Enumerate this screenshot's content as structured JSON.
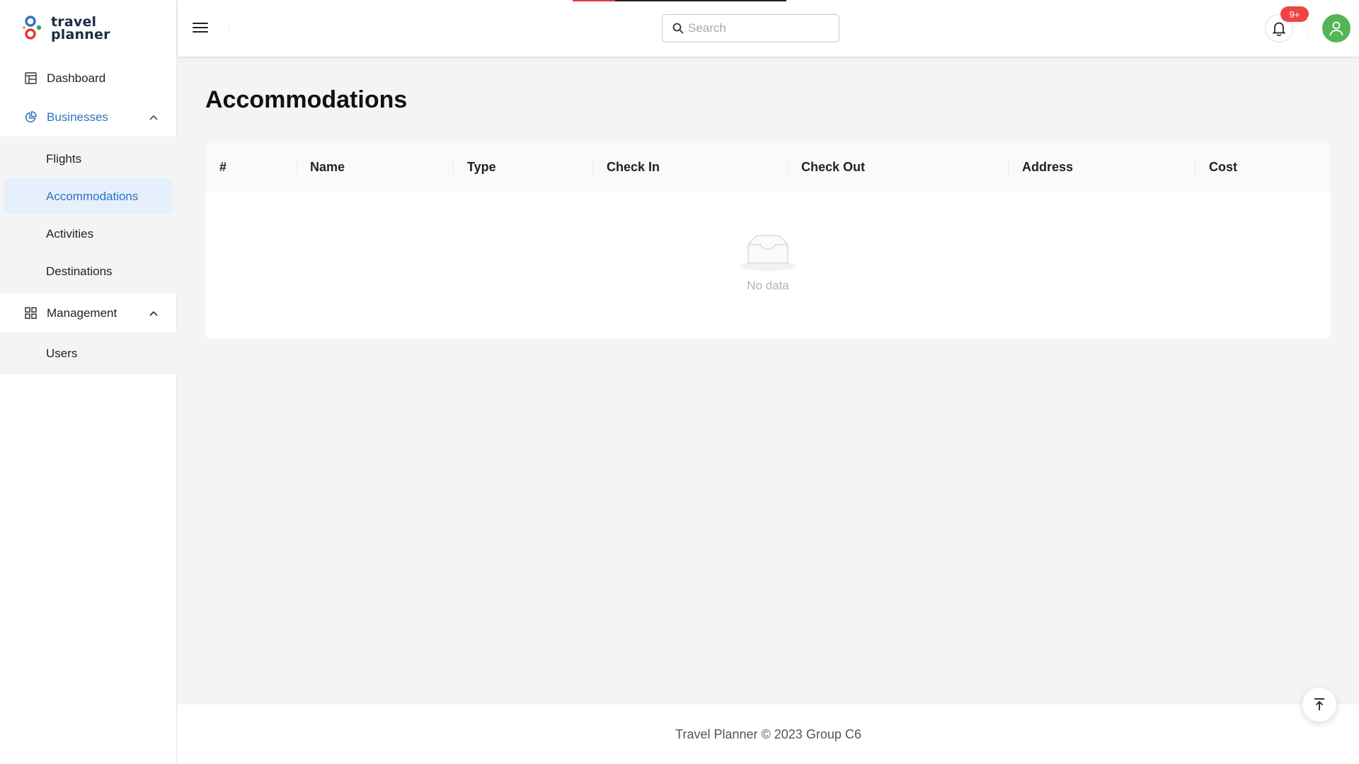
{
  "brand": {
    "line1": "travel",
    "line2": "planner"
  },
  "sidebar": {
    "items": [
      {
        "label": "Dashboard",
        "icon": "dashboard-icon"
      },
      {
        "label": "Businesses",
        "icon": "pie-chart-icon",
        "expanded": true,
        "children": [
          "Flights",
          "Accommodations",
          "Activities",
          "Destinations"
        ],
        "active_child": "Accommodations"
      },
      {
        "label": "Management",
        "icon": "grid-icon",
        "expanded": true,
        "children": [
          "Users"
        ]
      }
    ]
  },
  "header": {
    "search_placeholder": "Search",
    "notification_badge": "9+",
    "loading_progress": 0.2
  },
  "main": {
    "title": "Accommodations",
    "table": {
      "columns": [
        "#",
        "Name",
        "Type",
        "Check In",
        "Check Out",
        "Address",
        "Cost"
      ],
      "rows": [],
      "empty_text": "No data"
    }
  },
  "footer": {
    "text": "Travel Planner © 2023 Group C6"
  },
  "colors": {
    "accent": "#2f74c0",
    "active_bg": "#e5f0fc",
    "badge": "#ef4444",
    "avatar": "#53b556"
  }
}
